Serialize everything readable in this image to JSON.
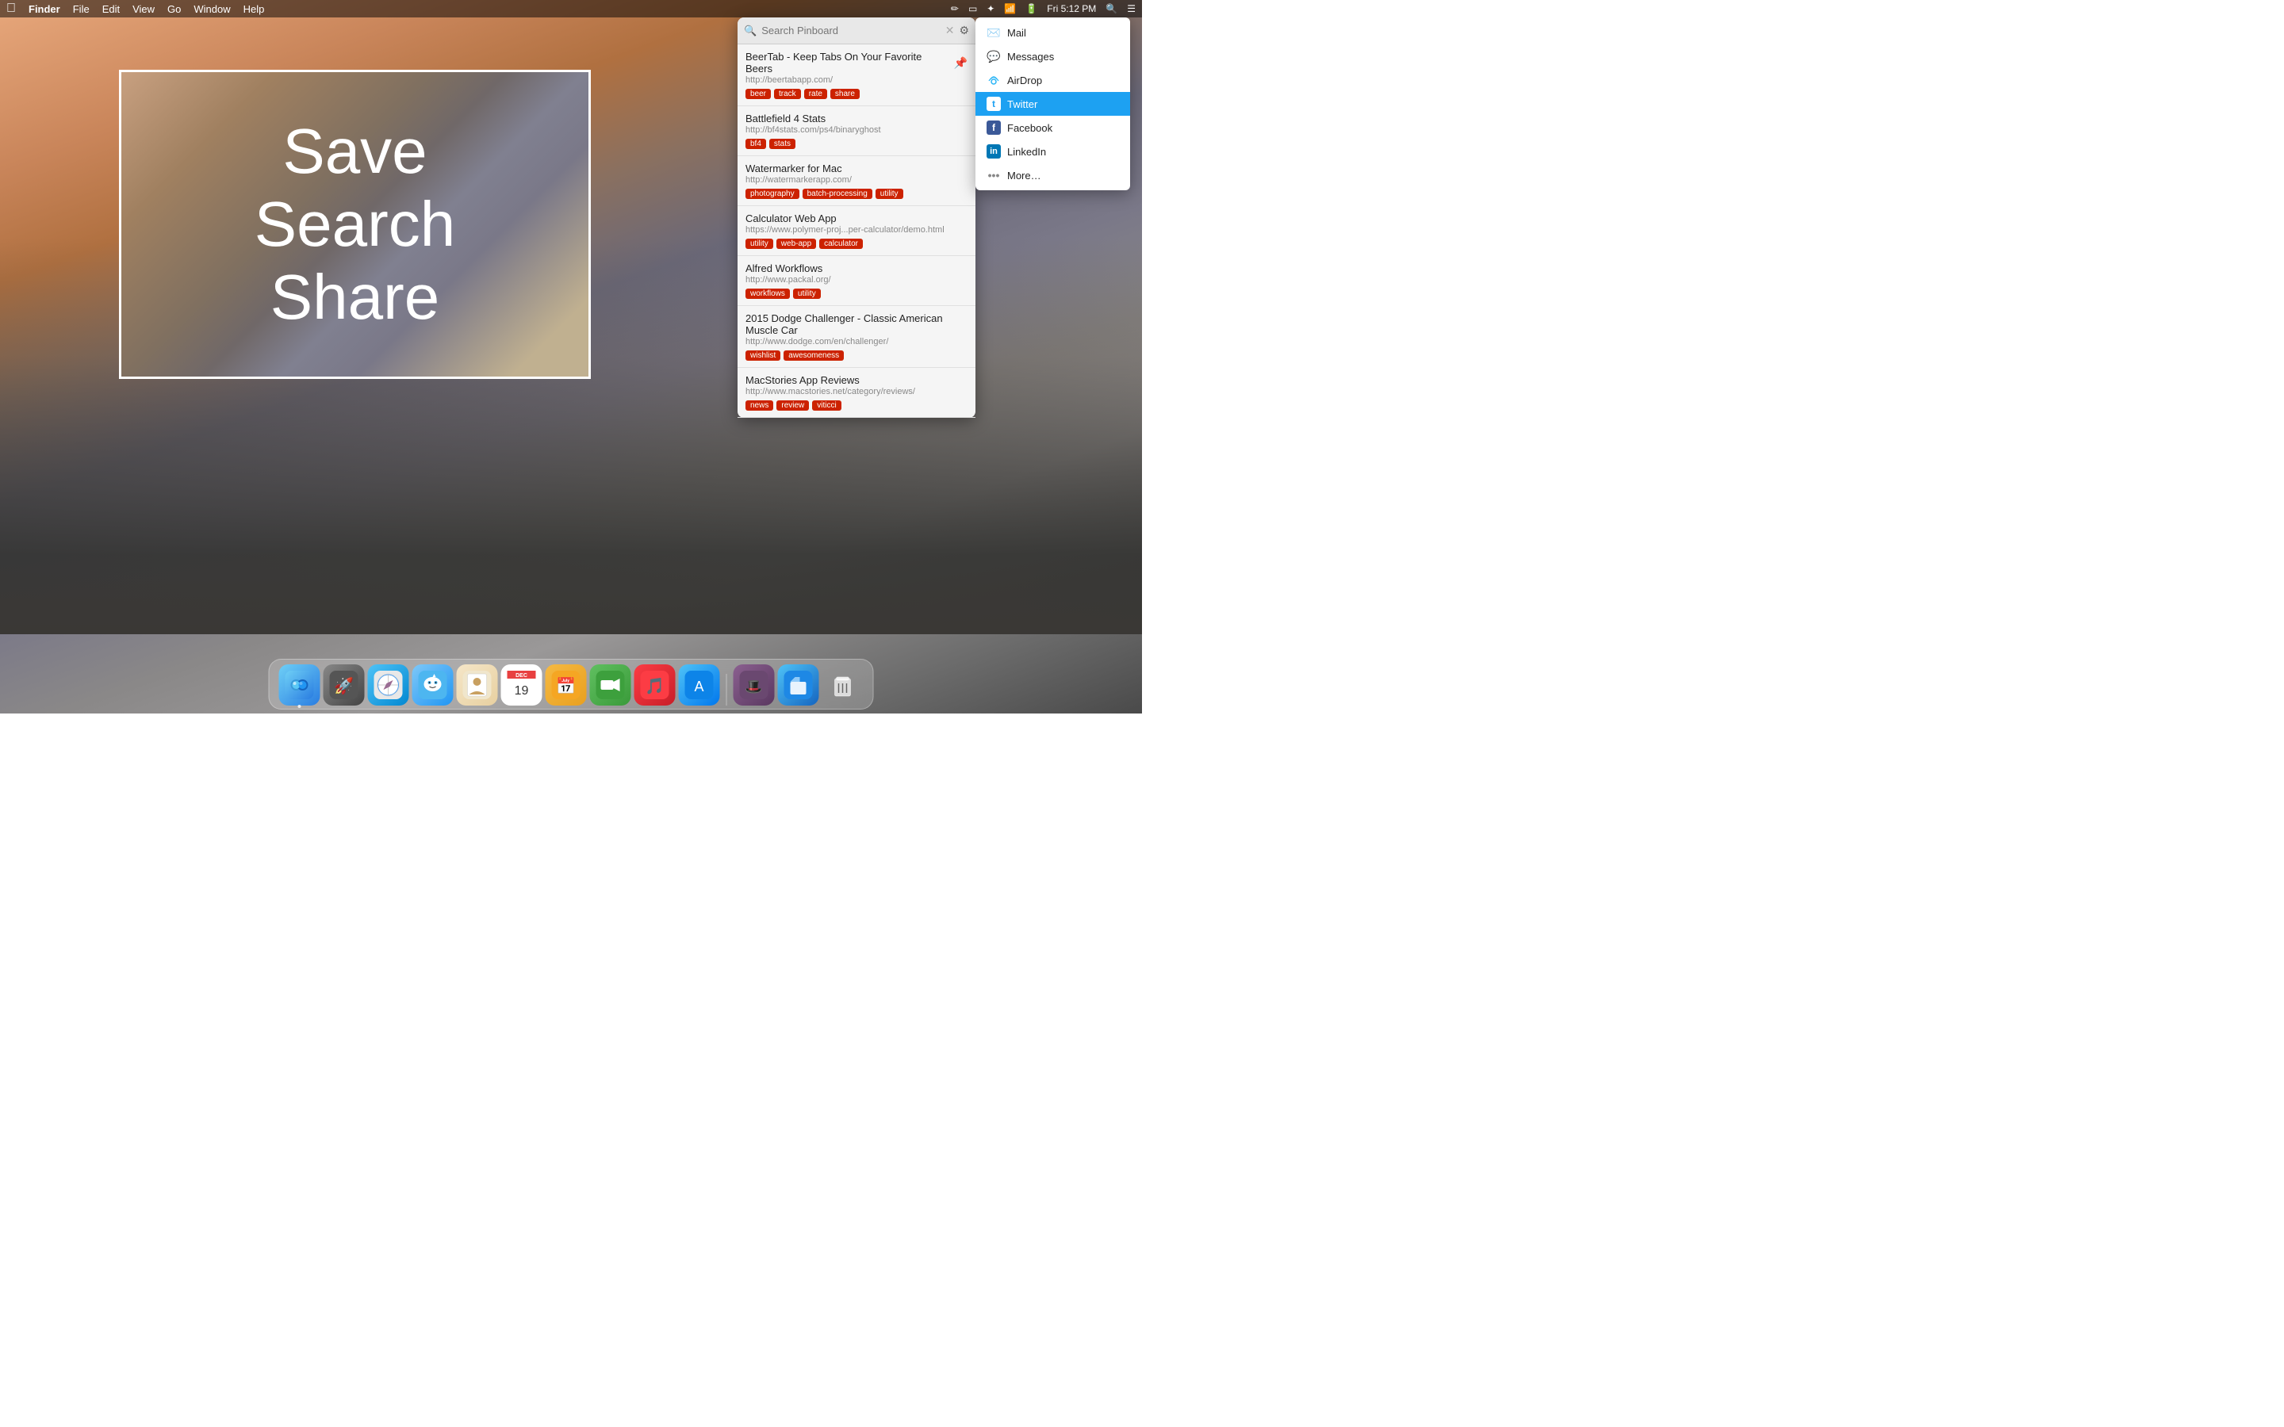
{
  "menubar": {
    "apple": "🍎",
    "app_name": "Finder",
    "menus": [
      "File",
      "Edit",
      "View",
      "Go",
      "Window",
      "Help"
    ],
    "right_items": [
      "Fri 5:12 PM"
    ],
    "time": "Fri 5:12 PM"
  },
  "hero": {
    "lines": [
      "Save",
      "Search",
      "Share"
    ]
  },
  "search": {
    "placeholder": "Search Pinboard"
  },
  "bookmarks": [
    {
      "title": "BeerTab - Keep Tabs On Your Favorite Beers",
      "url": "http://beertabapp.com/",
      "tags": [
        "beer",
        "track",
        "rate",
        "share"
      ],
      "pinned": true
    },
    {
      "title": "Battlefield 4 Stats",
      "url": "http://bf4stats.com/ps4/binaryghost",
      "tags": [
        "bf4",
        "stats"
      ],
      "pinned": false
    },
    {
      "title": "Watermarker for Mac",
      "url": "http://watermarkerapp.com/",
      "tags": [
        "photography",
        "batch-processing",
        "utility"
      ],
      "pinned": false
    },
    {
      "title": "Calculator Web App",
      "url": "https://www.polymer-proj...per-calculator/demo.html",
      "tags": [
        "utility",
        "web-app",
        "calculator"
      ],
      "pinned": false
    },
    {
      "title": "Alfred Workflows",
      "url": "http://www.packal.org/",
      "tags": [
        "workflows",
        "utility"
      ],
      "pinned": false
    },
    {
      "title": "2015 Dodge Challenger - Classic American Muscle Car",
      "url": "http://www.dodge.com/en/challenger/",
      "tags": [
        "wishlist",
        "awesomeness"
      ],
      "pinned": false
    },
    {
      "title": "MacStories App Reviews",
      "url": "http://www.macstories.net/category/reviews/",
      "tags": [
        "news",
        "review",
        "viticci"
      ],
      "pinned": false
    }
  ],
  "share_menu": {
    "items": [
      {
        "id": "mail",
        "label": "Mail",
        "icon": "✉"
      },
      {
        "id": "messages",
        "label": "Messages",
        "icon": "💬"
      },
      {
        "id": "airdrop",
        "label": "AirDrop",
        "icon": "📡"
      },
      {
        "id": "twitter",
        "label": "Twitter",
        "icon": "t",
        "active": true
      },
      {
        "id": "facebook",
        "label": "Facebook",
        "icon": "f"
      },
      {
        "id": "linkedin",
        "label": "LinkedIn",
        "icon": "in"
      },
      {
        "id": "more",
        "label": "More…",
        "icon": "···"
      }
    ]
  },
  "dock": {
    "items": [
      {
        "id": "finder",
        "label": "Finder"
      },
      {
        "id": "launchpad",
        "label": "Launchpad"
      },
      {
        "id": "safari",
        "label": "Safari"
      },
      {
        "id": "tweetbot",
        "label": "Tweetbot"
      },
      {
        "id": "contacts",
        "label": "Contacts"
      },
      {
        "id": "calendar",
        "label": "Calendar"
      },
      {
        "id": "fantastical",
        "label": "Fantastical"
      },
      {
        "id": "facetime",
        "label": "FaceTime"
      },
      {
        "id": "music",
        "label": "Music"
      },
      {
        "id": "appstore",
        "label": "App Store"
      },
      {
        "id": "alfred",
        "label": "Alfred"
      },
      {
        "id": "files",
        "label": "Files"
      },
      {
        "id": "trash",
        "label": "Trash"
      }
    ]
  }
}
